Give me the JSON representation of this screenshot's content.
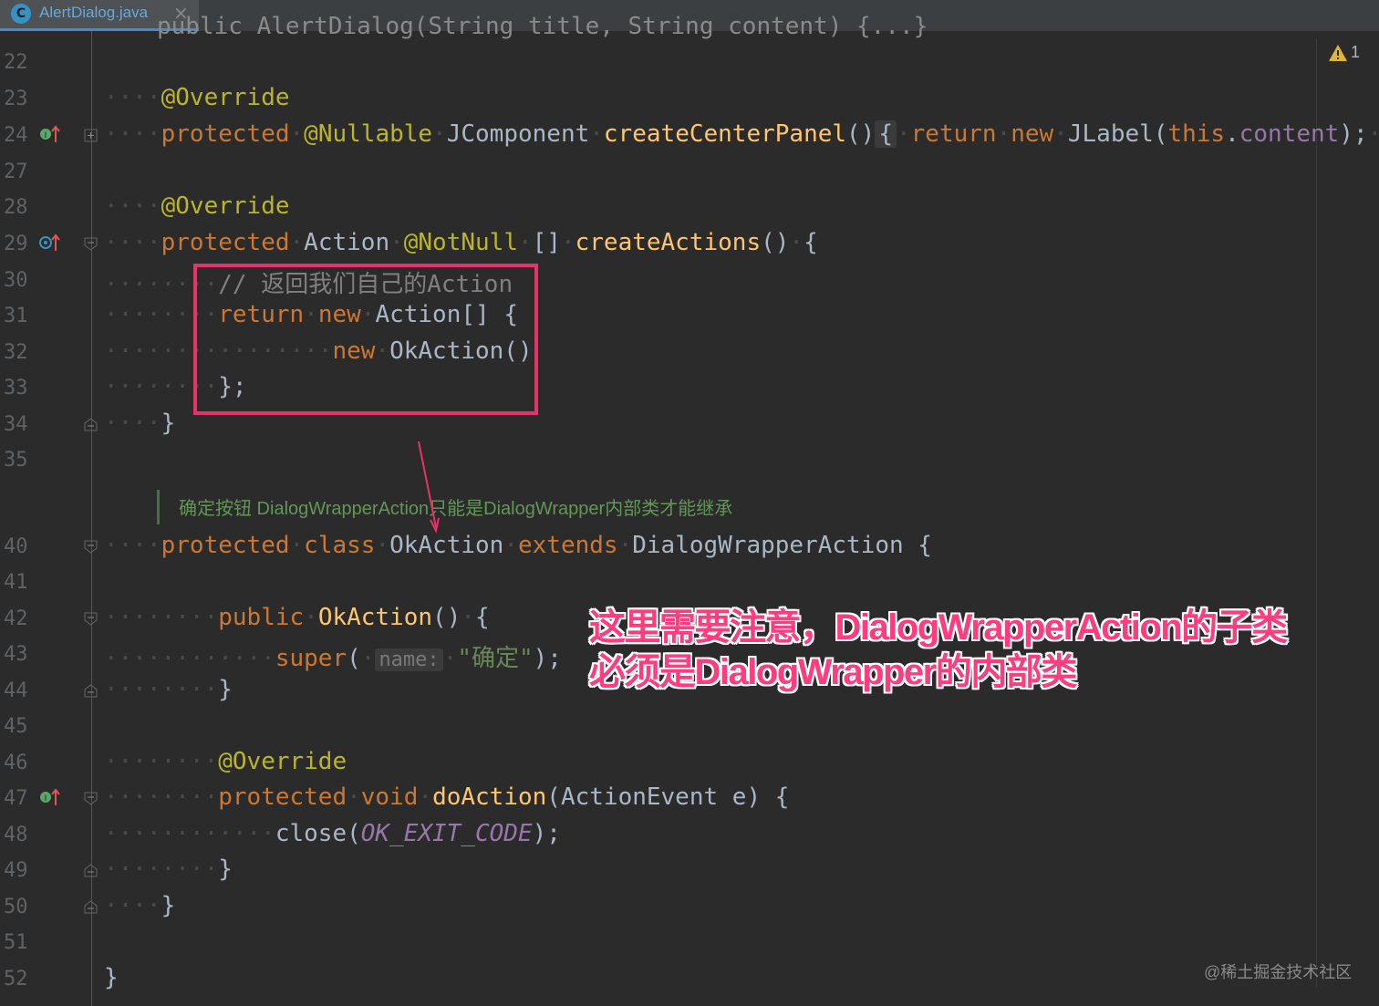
{
  "tab": {
    "title": "AlertDialog.java",
    "icon_letter": "C",
    "close_glyph": "×"
  },
  "inspection": {
    "warning_count": "1"
  },
  "lines": {
    "l22": "22",
    "l23": "23",
    "l24": "24",
    "l27": "27",
    "l28": "28",
    "l29": "29",
    "l30": "30",
    "l31": "31",
    "l32": "32",
    "l33": "33",
    "l34": "34",
    "l35": "35",
    "l40": "40",
    "l41": "41",
    "l42": "42",
    "l43": "43",
    "l44": "44",
    "l45": "45",
    "l46": "46",
    "l47": "47",
    "l48": "48",
    "l49": "49",
    "l50": "50",
    "l51": "51",
    "l52": "52"
  },
  "code": {
    "top_partial": "public AlertDialog(String title, String content) {...}",
    "override": "@Override",
    "protected": "protected",
    "nullable": "@Nullable",
    "jcomponent": "JComponent",
    "create_center_panel": "createCenterPanel",
    "return_kw": "return",
    "new_kw": "new",
    "jlabel": "JLabel(",
    "this_kw": "this",
    "content_field": "content",
    "action_type": "Action",
    "notnull": "@NotNull",
    "create_actions": "createActions",
    "comment": "// 返回我们自己的Action",
    "action_array": "Action[] {",
    "ok_action_call": "OkAction()",
    "close_arr": "};",
    "close_brace": "}",
    "class_kw": "class",
    "ok_action": "OkAction",
    "extends_kw": "extends",
    "dialog_wrapper_action": "DialogWrapperAction {",
    "public_kw": "public",
    "super_kw": "super",
    "param_hint": "name:",
    "ok_string": "\"确定\"",
    "void_kw": "void",
    "do_action": "doAction",
    "do_action_params": "(ActionEvent e) {",
    "close_call": "close(",
    "ok_exit_code": "OK_EXIT_CODE"
  },
  "javadoc": "确定按钮 DialogWrapperAction只能是DialogWrapper内部类才能继承",
  "annotation": {
    "line1": "这里需要注意，DialogWrapperAction的子类",
    "line2": "必须是DialogWrapper的内部类"
  },
  "watermark": "@稀土掘金技术社区",
  "colors": {
    "highlight_box": "#e8336a",
    "annotation": "#ff3c7e",
    "tab_underline": "#4a88c7"
  }
}
